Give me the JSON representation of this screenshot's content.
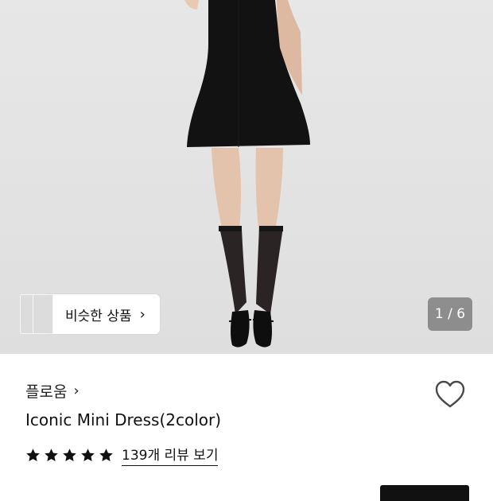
{
  "photo": {
    "bg": "#e5e5e5"
  },
  "similar": {
    "label": "비슷한 상품",
    "chevron": "›"
  },
  "pager": {
    "current": "1",
    "total": "6",
    "text": "1 / 6"
  },
  "brand": {
    "name": "플로움",
    "chevron": "›"
  },
  "product": {
    "title": "Iconic Mini Dress(2color)"
  },
  "rating": {
    "stars": 5,
    "review_text": "139개 리뷰 보기"
  },
  "icons": {
    "heart": "heart-outline-icon",
    "star": "star-filled-icon"
  },
  "colors": {
    "dress": "#111111",
    "pager_bg": "#6e6e6e",
    "text": "#111111"
  }
}
